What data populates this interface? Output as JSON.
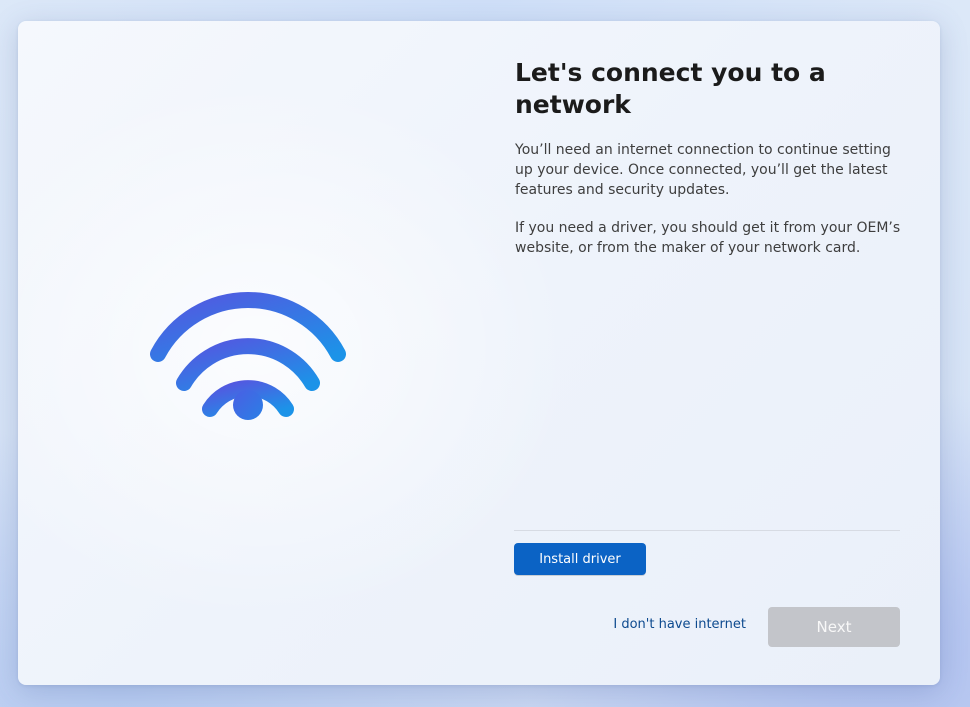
{
  "page": {
    "title": "Let's connect you to a network",
    "description_1": "You’ll need an internet connection to continue setting up your device. Once connected, you’ll get the latest features and security updates.",
    "description_2": "If you need a driver, you should get it from your OEM’s website, or from the maker of your network card.",
    "illustration_icon": "wifi-icon"
  },
  "actions": {
    "install_driver_label": "Install driver",
    "no_internet_label": "I don't have internet",
    "next_label": "Next",
    "next_enabled": false
  },
  "colors": {
    "primary_button": "#0b63c5",
    "link": "#0d4a8f",
    "disabled_button": "#c3c5ca",
    "wifi_gradient_start": "#4f5ce0",
    "wifi_gradient_end": "#1f8fe6"
  }
}
